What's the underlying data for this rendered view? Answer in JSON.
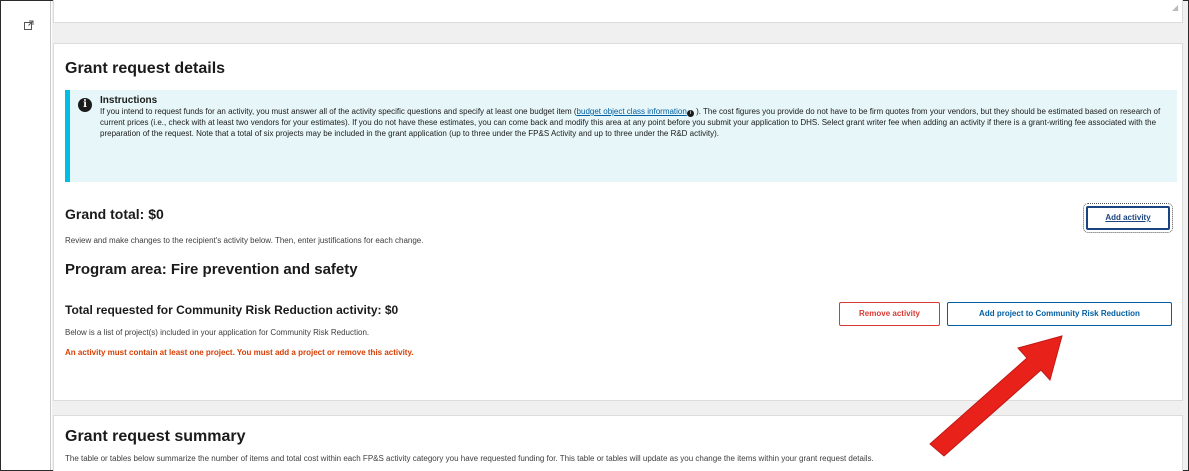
{
  "icons": {
    "external_link": "external-link-icon",
    "info": "info-icon",
    "arrow": "red-arrow"
  },
  "colors": {
    "alert_bg": "#e7f6f8",
    "alert_border": "#00bde3",
    "primary": "#1a4480",
    "link": "#005ea2",
    "danger": "#d83933",
    "error_text": "#d63e04",
    "arrow": "#e8221b"
  },
  "grant_details": {
    "title": "Grant request details",
    "instructions": {
      "title": "Instructions",
      "body_before_link": "If you intend to request funds for an activity, you must answer all of the activity specific questions and specify at least one budget item (",
      "link_text": "budget object class information",
      "body_after_link": " ). The cost figures you provide do not have to be firm quotes from your vendors, but they should be estimated based on research of current prices (i.e., check with at least two vendors for your estimates). If you do not have these estimates, you can come back and modify this area at any point before you submit your application to DHS. Select grant writer fee when adding an activity if there is a grant-writing fee associated with the preparation of the request. Note that a total of six projects may be included in the grant application (up to three under the FP&S Activity and up to three under the R&D activity)."
    },
    "grand_total": "Grand total: $0",
    "add_activity_label": "Add activity",
    "review_text": "Review and make changes to the recipient's activity below. Then, enter justifications for each change.",
    "program_area": "Program area: Fire prevention and safety",
    "total_requested": "Total requested for Community Risk Reduction activity: $0",
    "remove_activity_label": "Remove activity",
    "add_project_label": "Add project to Community Risk Reduction",
    "list_text": "Below is a list of project(s) included in your application for Community Risk Reduction.",
    "error_text": "An activity must contain at least one project. You must add a project or remove this activity."
  },
  "summary": {
    "title": "Grant request summary",
    "text": "The table or tables below summarize the number of items and total cost within each FP&S activity category you have requested funding for. This table or tables will update as you change the items within your grant request details."
  }
}
